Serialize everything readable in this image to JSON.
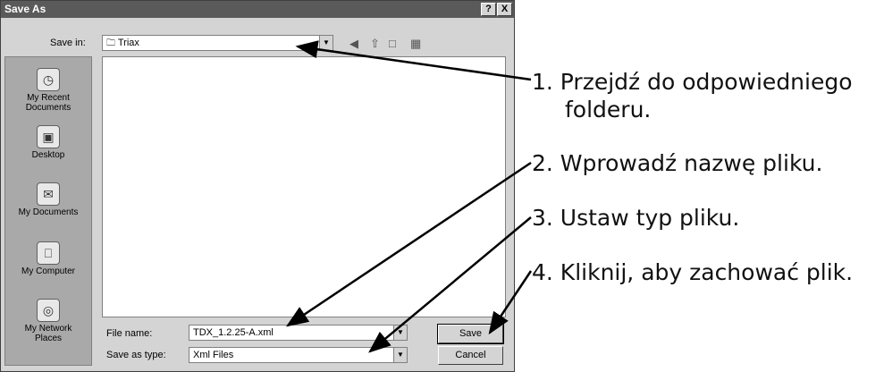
{
  "dialog": {
    "title": "Save As",
    "help_button": "?",
    "close_button": "X",
    "save_in_label": "Save in:",
    "save_in_value": "Triax",
    "places": [
      {
        "label": "My Recent\nDocuments",
        "icon": "recent-documents-icon"
      },
      {
        "label": "Desktop",
        "icon": "desktop-icon"
      },
      {
        "label": "My Documents",
        "icon": "my-documents-icon"
      },
      {
        "label": "My Computer",
        "icon": "my-computer-icon"
      },
      {
        "label": "My Network\nPlaces",
        "icon": "network-places-icon"
      }
    ],
    "file_name_label": "File name:",
    "file_name_value": "TDX_1.2.25-A.xml",
    "save_as_type_label": "Save as type:",
    "save_as_type_value": "Xml Files",
    "save_button": "Save",
    "cancel_button": "Cancel"
  },
  "callouts": {
    "step1_line1": "1. Przejdź do odpowiedniego",
    "step1_line2": "folderu.",
    "step2": "2. Wprowadź nazwę pliku.",
    "step3": "3. Ustaw typ pliku.",
    "step4": "4. Kliknij, aby zachować plik."
  }
}
